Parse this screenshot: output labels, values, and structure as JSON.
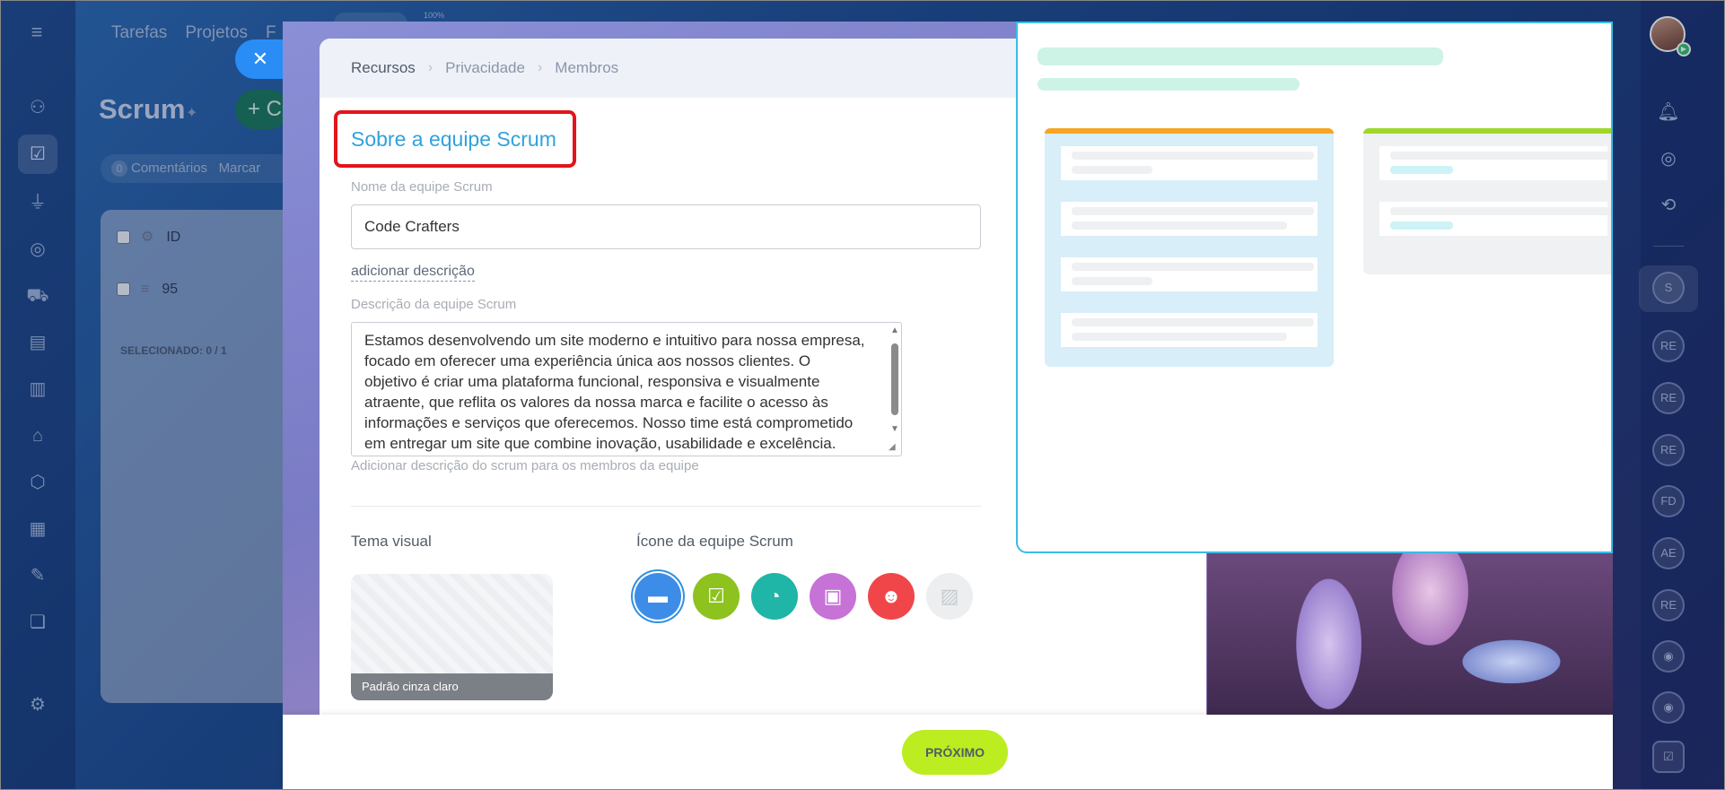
{
  "background": {
    "nav": {
      "tabs": [
        "Tarefas",
        "Projetos",
        "F"
      ],
      "zoom": "100%"
    },
    "title": "Scrum",
    "create_label": "+ C",
    "comments": {
      "count": "0",
      "label": "Comentários",
      "filter": "Marcar"
    },
    "grid": {
      "header_id": "ID",
      "row_id": "95",
      "selected_label": "SELECIONADO:",
      "selected_value": "0 / 1"
    }
  },
  "right_rail": {
    "avatars": [
      "S",
      "RE",
      "RE",
      "RE",
      "FD",
      "AE",
      "RE"
    ]
  },
  "breadcrumbs": {
    "items": [
      "Recursos",
      "Privacidade",
      "Membros"
    ]
  },
  "form": {
    "heading": "Sobre a equipe Scrum",
    "name_label": "Nome da equipe Scrum",
    "name_value": "Code Crafters",
    "add_description": "adicionar descrição",
    "description_label": "Descrição da equipe Scrum",
    "description_value": "Estamos desenvolvendo um site moderno e intuitivo para nossa empresa, focado em oferecer uma experiência única aos nossos clientes. O objetivo é criar uma plataforma funcional, responsiva e visualmente atraente, que reflita os valores da nossa marca e facilite o acesso às informações e serviços que oferecemos. Nosso time está comprometido em entregar um site que combine inovação, usabilidade e excelência.",
    "description_hint": "Adicionar descrição do scrum para os membros da equipe",
    "theme_label": "Tema visual",
    "theme_caption": "Padrão cinza claro",
    "icon_label": "Ícone da equipe Scrum",
    "icons": [
      {
        "name": "folder-icon",
        "glyph": "▬",
        "color": "#3d8de8",
        "selected": true
      },
      {
        "name": "checklist-icon",
        "glyph": "☑",
        "color": "#8dc21f",
        "selected": false
      },
      {
        "name": "pie-chart-icon",
        "glyph": "◔",
        "color": "#1fb5a7",
        "selected": false
      },
      {
        "name": "briefcase-icon",
        "glyph": "▣",
        "color": "#c672d6",
        "selected": false
      },
      {
        "name": "team-icon",
        "glyph": "☻",
        "color": "#f0464a",
        "selected": false
      },
      {
        "name": "image-icon",
        "glyph": "▨",
        "color": "#eceef0",
        "selected": false
      }
    ]
  },
  "footer": {
    "next_label": "PRÓXIMO"
  },
  "colors": {
    "accent": "#2fa2dd",
    "next_button": "#bbed21",
    "highlight_box": "#e3141b",
    "close_button": "#2a8cf5"
  }
}
